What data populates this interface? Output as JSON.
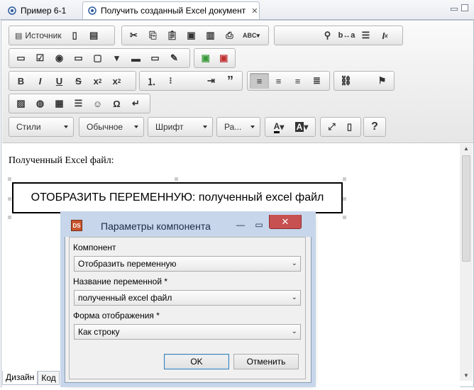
{
  "tabs": [
    {
      "label": "Пример 6-1"
    },
    {
      "label": "Получить созданный Excel документ"
    }
  ],
  "toolbar": {
    "source_label": "Источник",
    "styles_combo": "Стили",
    "format_combo": "Обычное",
    "font_combo": "Шрифт",
    "size_combo": "Ра...",
    "help_label": "?"
  },
  "content": {
    "paragraph": "Полученный Excel файл:",
    "widget_text": "ОТОБРАЗИТЬ ПЕРЕМЕННУЮ: полученный excel файл"
  },
  "bottom_tabs": [
    {
      "label": "Дизайн"
    },
    {
      "label": "Код"
    }
  ],
  "dialog": {
    "title": "Параметры компонента",
    "icon_text": "DS",
    "fields": [
      {
        "label": "Компонент",
        "value": "Отобразить переменную"
      },
      {
        "label": "Название переменной *",
        "value": "полученный excel файл"
      },
      {
        "label": "Форма отображения *",
        "value": "Как строку"
      }
    ],
    "ok_label": "OK",
    "cancel_label": "Отменить"
  },
  "colors": {
    "dialog_frame": "#c7d6ea",
    "close_button": "#c75050",
    "tab_border": "#b7bfcc"
  }
}
